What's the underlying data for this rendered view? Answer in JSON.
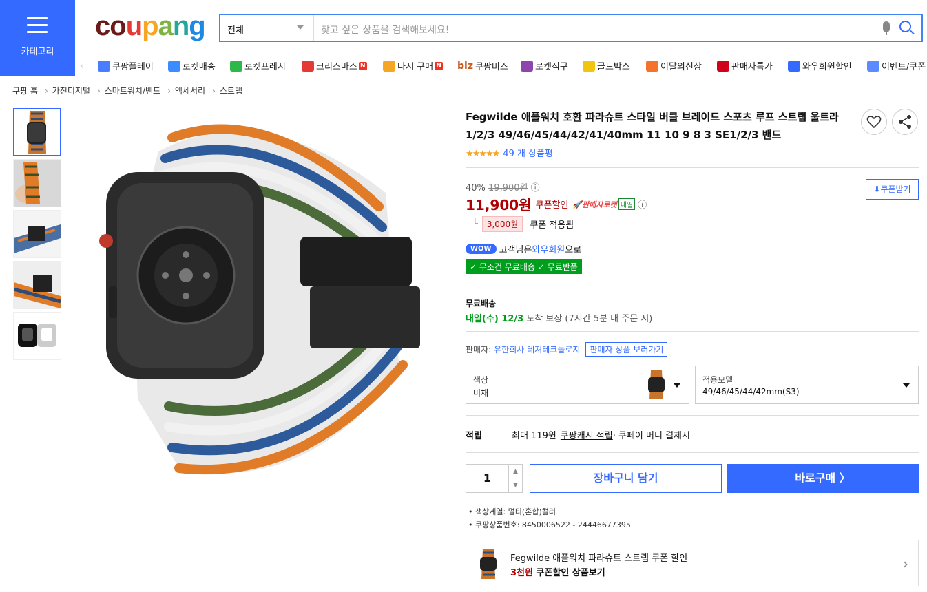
{
  "header": {
    "category_label": "카테고리",
    "logo": "coupang",
    "search": {
      "category": "전체",
      "placeholder": "찾고 싶은 상품을 검색해보세요!"
    }
  },
  "nav": [
    {
      "label": "쿠팡플레이",
      "icon": "play-icon",
      "color": "#4a7cff"
    },
    {
      "label": "로켓배송",
      "icon": "rocket-icon",
      "color": "#3a8cff"
    },
    {
      "label": "로켓프레시",
      "icon": "rocket-fresh-icon",
      "color": "#2db84a"
    },
    {
      "label": "크리스마스",
      "icon": "santa-icon",
      "color": "#e53935",
      "badge": "N"
    },
    {
      "label": "다시 구매",
      "icon": "house-icon",
      "color": "#f5a623",
      "badge": "N"
    },
    {
      "label": "쿠팡비즈",
      "prefix": "biz",
      "icon": "biz-icon",
      "color": "#c75a1e"
    },
    {
      "label": "로켓직구",
      "icon": "globe-rocket-icon",
      "color": "#8e44ad"
    },
    {
      "label": "골드박스",
      "icon": "gold-box-icon",
      "color": "#f1c40f"
    },
    {
      "label": "이달의신상",
      "icon": "bag-icon",
      "color": "#f4722b"
    },
    {
      "label": "판매자특가",
      "icon": "percent-icon",
      "color": "#d0021b"
    },
    {
      "label": "와우회원할인",
      "icon": "wow-icon",
      "color": "#346aff"
    },
    {
      "label": "이벤트/쿠폰",
      "icon": "coupon-icon",
      "color": "#5b8cff"
    }
  ],
  "breadcrumb": [
    "쿠팡 홈",
    "가전디지털",
    "스마트워치/밴드",
    "액세서리",
    "스트랩"
  ],
  "product": {
    "title": "Fegwilde 애플워치 호환 파라슈트 스타일 버클 브레이드 스포츠 루프 스트랩 울트라1/2/3 49/46/45/44/42/41/40mm 11 10 9 8 3 SE1/2/3 밴드",
    "rating": 4.5,
    "review_count": "49 개 상품평",
    "discount_rate": "40%",
    "original_price": "19,900원",
    "price": "11,900원",
    "coupon_label": "쿠폰할인",
    "rocket_label": "판매자로켓",
    "rocket_day": "내일",
    "coupon_button": "쿠폰받기",
    "coupon_amount": "3,000원",
    "coupon_applied": "쿠폰 적용됨",
    "wow_badge": "WOW",
    "wow_text_pre": "고객님은 ",
    "wow_text_mid": "와우회원",
    "wow_text_post": "으로",
    "free_badges": "✓ 무조건 무료배송  ✓ 무료반품",
    "shipping_title": "무료배송",
    "shipping_date": "내일(수) 12/3",
    "shipping_rest": " 도착 보장 (7시간 5분 내 주문 시)",
    "seller_label": "판매자:",
    "seller_name": "유한회사 레져테크놀로지",
    "seller_button": "판매자 상품 보러가기",
    "option1": {
      "label": "색상",
      "value": "미채"
    },
    "option2": {
      "label": "적용모델",
      "value": "49/46/45/44/42mm(S3)"
    },
    "points_label": "적립",
    "points_text": "최대 119원",
    "points_link": "쿠팡캐시 적립",
    "points_rest": " · 쿠페이 머니 결제시",
    "quantity": "1",
    "cart_button": "장바구니 담기",
    "buy_button": "바로구매 〉",
    "info": [
      "색상계열: 멀티(혼합)컬러",
      "쿠팡상품번호: 8450006522 - 24446677395"
    ],
    "promo_title": "Fegwilde 애플워치 파라슈트 스트랩  쿠폰 할인",
    "promo_red": "3천원",
    "promo_rest": " 쿠폰할인 상품보기"
  },
  "colors": {
    "brand": "#346aff",
    "price": "#ae0000",
    "green": "#009e1c"
  }
}
